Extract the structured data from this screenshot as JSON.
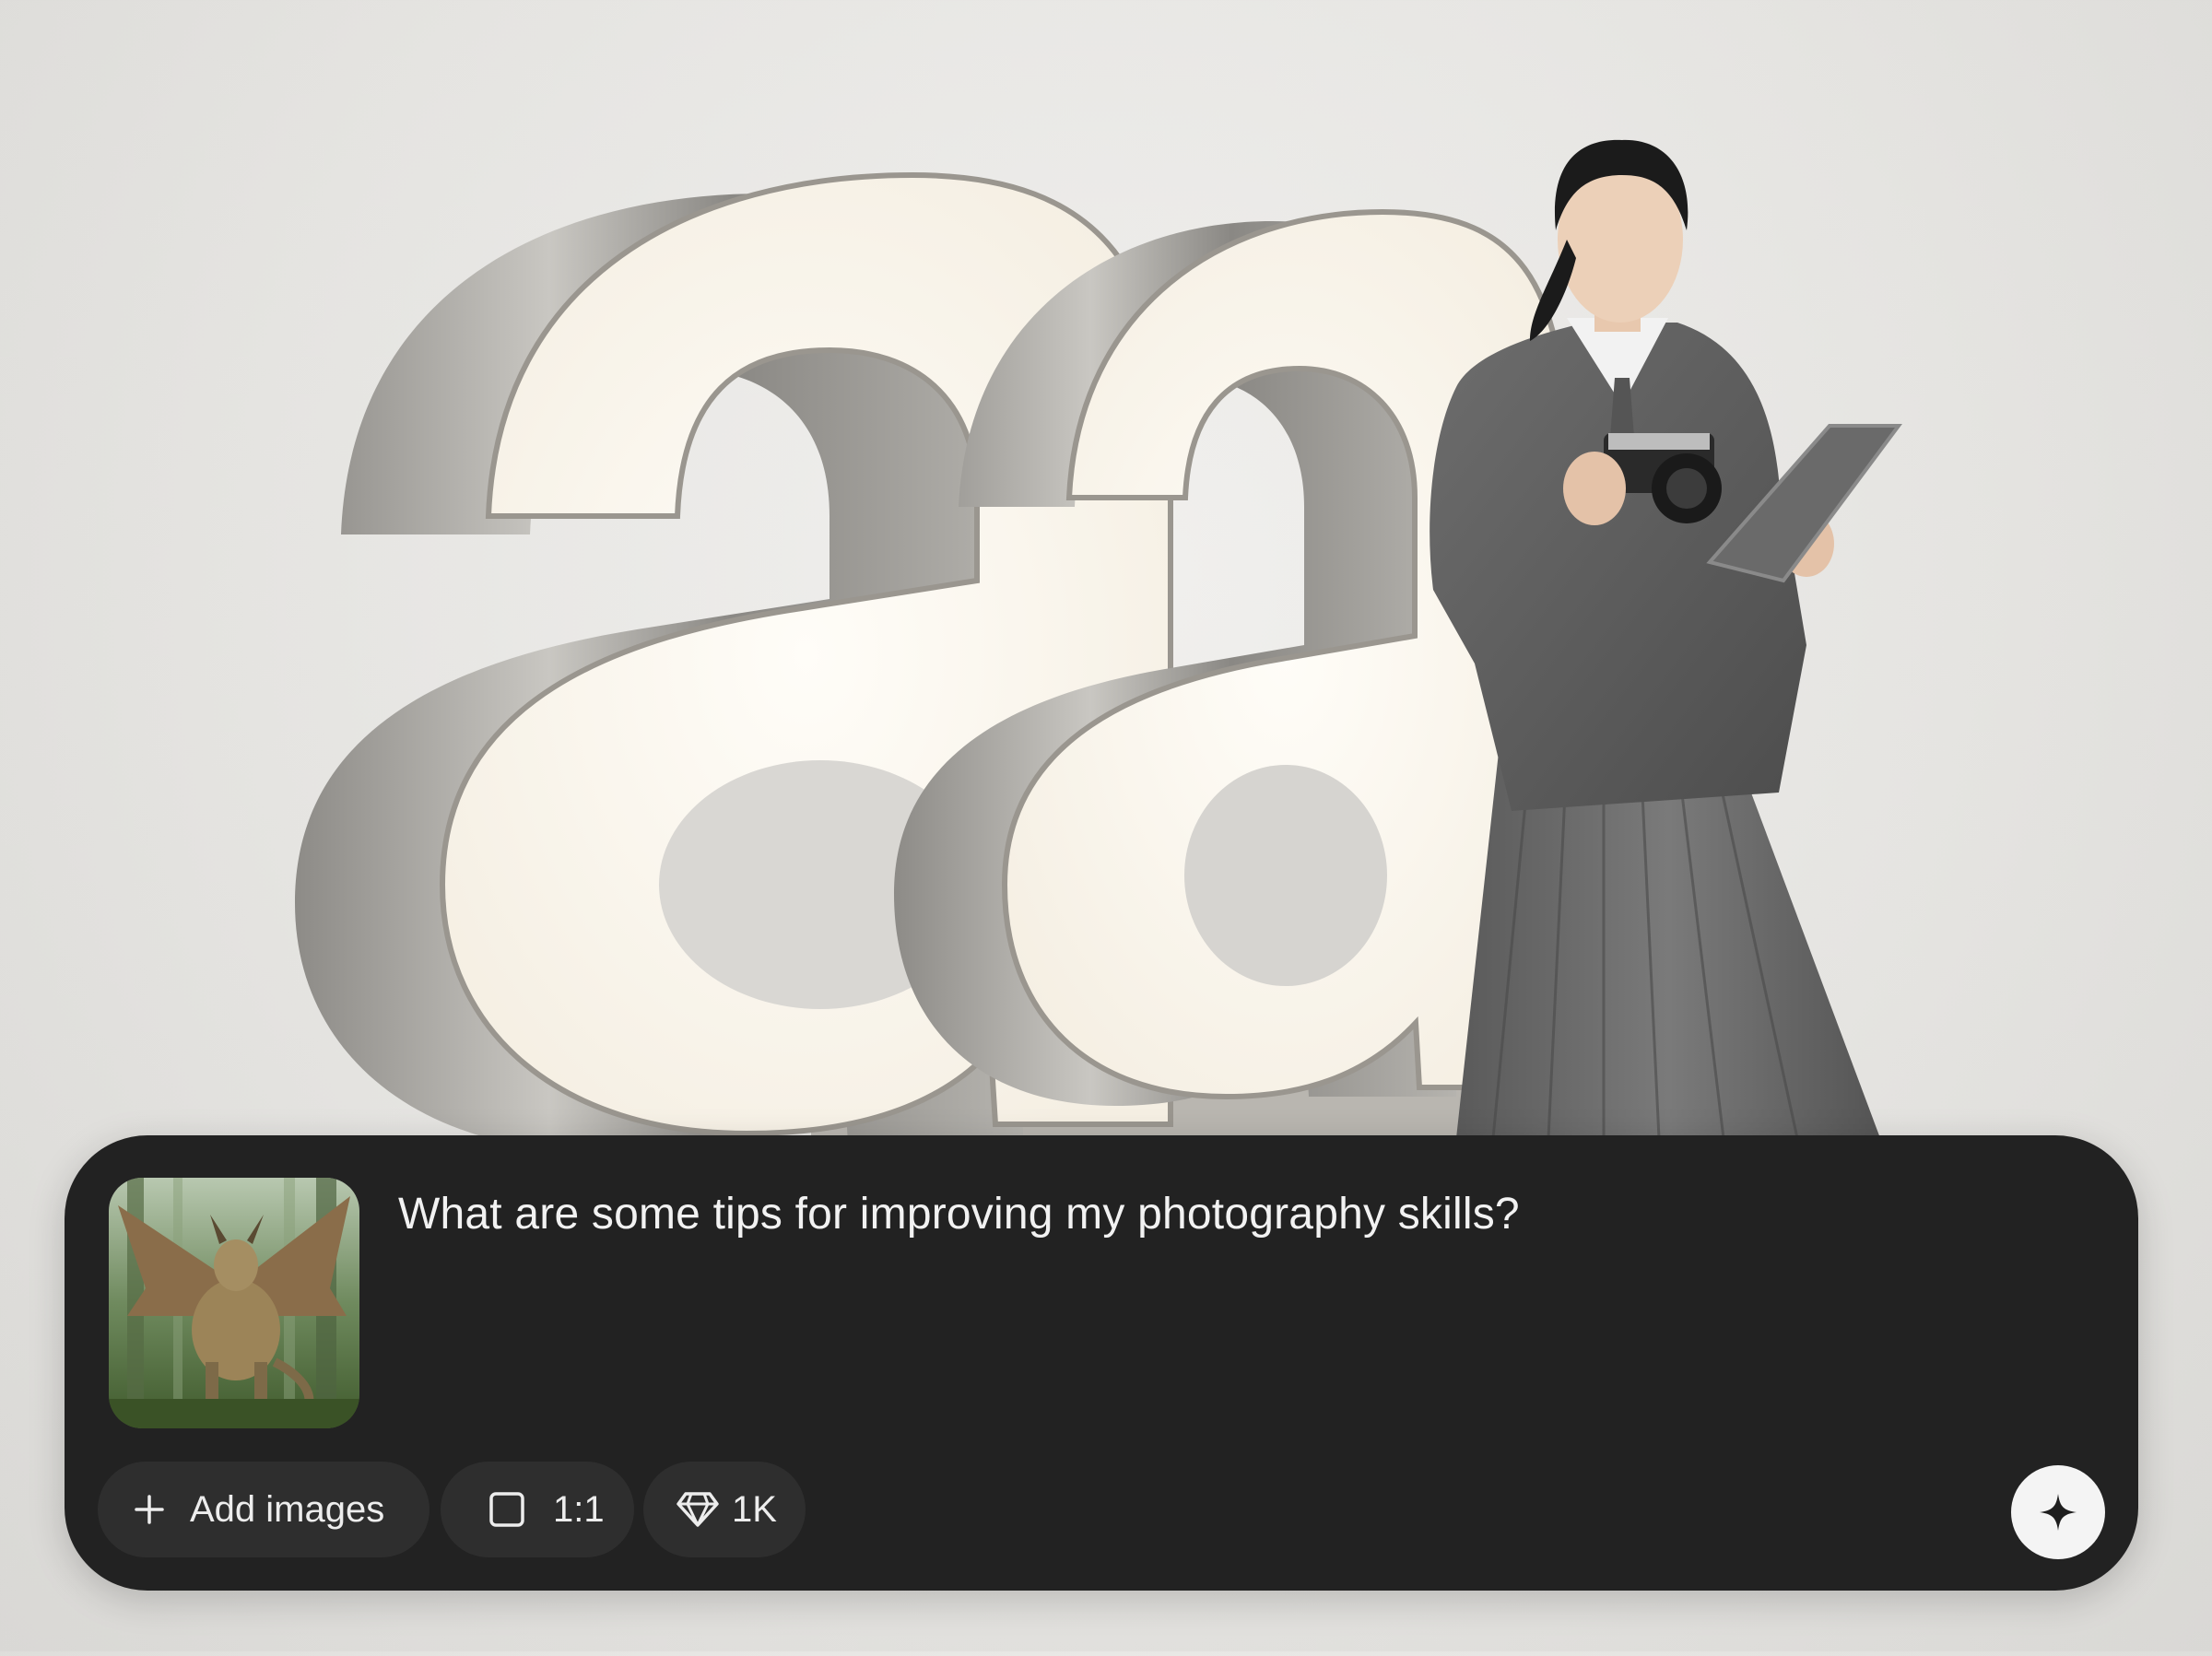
{
  "composer": {
    "prompt_text": "What are some tips for improving my photography skills?",
    "attachment": {
      "icon": "dragon-image-thumbnail"
    },
    "add_images_label": "Add images",
    "aspect_ratio_label": "1:1",
    "resolution_label": "1K",
    "generate_icon": "sparkle-icon"
  },
  "colors": {
    "composer_bg": "#222222",
    "chip_bg": "#2e2e2e",
    "text": "#f2f2f2",
    "generate_button_bg": "#f4f4f4"
  }
}
